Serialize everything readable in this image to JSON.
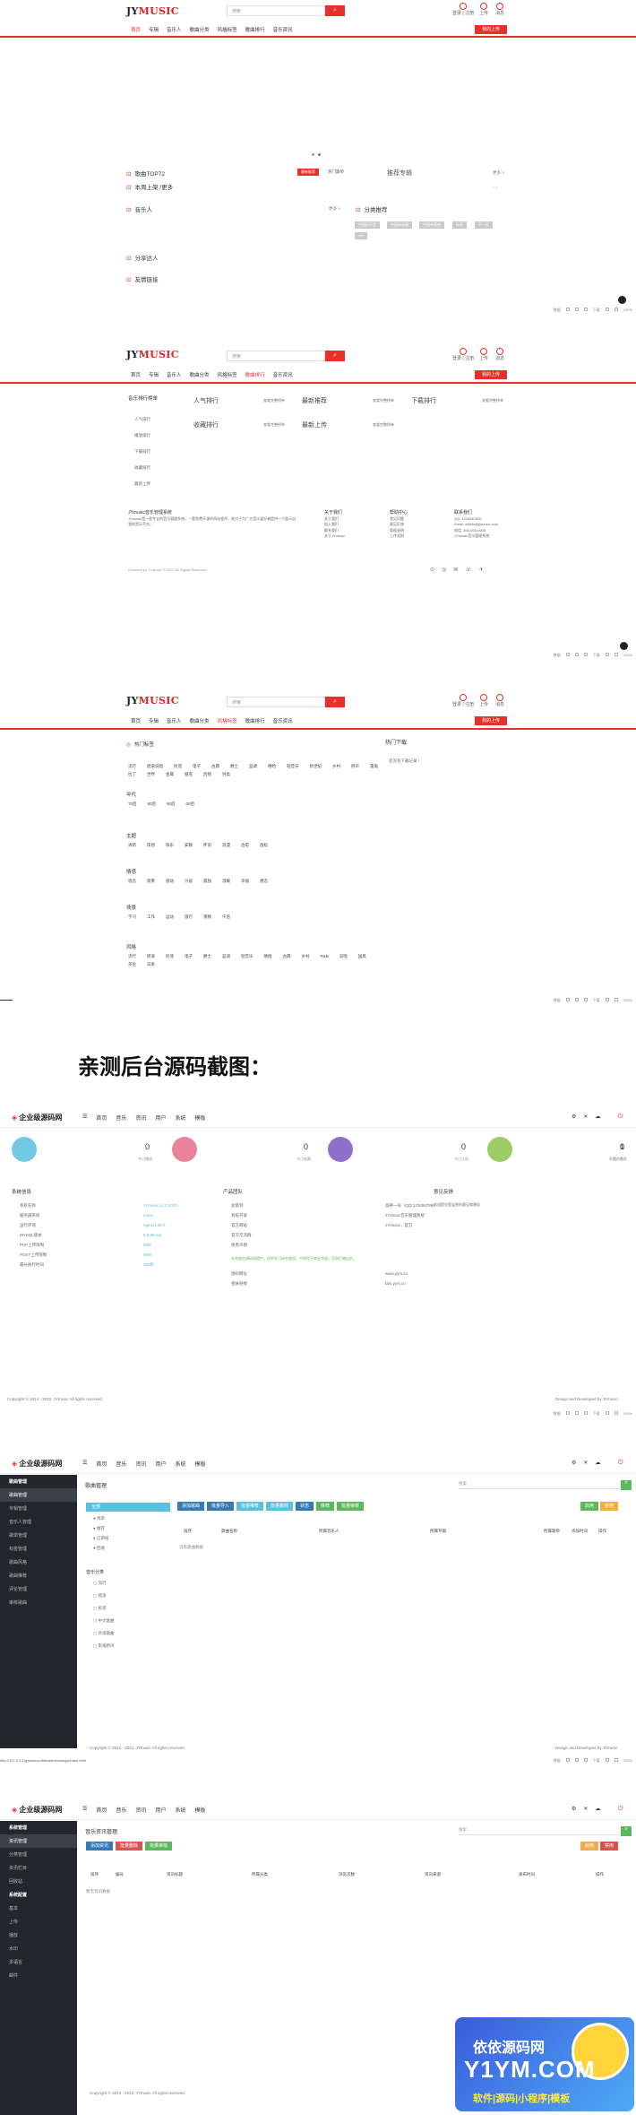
{
  "site": {
    "logo_prefix": "JY",
    "logo_suffix": "MUSIC",
    "search_placeholder": "搜索",
    "search_value_1": "搜索",
    "search_value_2": "搜索",
    "search_value_3": "搜索",
    "login_text": "登录 | 注册",
    "upload_label": "上传",
    "notify_label": "消息",
    "upload_btn": "我的上传",
    "nav": [
      "首页",
      "专辑",
      "音乐人",
      "歌曲分类",
      "风格标签",
      "歌曲排行",
      "音乐资讯"
    ]
  },
  "page1": {
    "top_label": "歌曲TOP72",
    "top_badge": "最新推荐",
    "hot_label": "热门歌单",
    "rec_label": "推荐专辑",
    "more1": "更多 >",
    "sub_label": "本周上架 /更多",
    "singer_label": "音乐人",
    "more2": "更多 >",
    "cat_label": "分类推荐",
    "cat_tags": [
      "中国好声音",
      "中国新说唱",
      "中国有嘻哈",
      "标签",
      "不一样"
    ],
    "cat_tag_extra": "MV",
    "share_label": "分享达人",
    "links_label": "友情链接"
  },
  "statusbar": {
    "items": [
      "数据",
      "下载",
      "100%"
    ]
  },
  "page2": {
    "panel_title": "音乐排行榜单",
    "list": [
      "人气排行",
      "播放排行",
      "下载排行",
      "收藏排行",
      "最新上传"
    ],
    "rank_titles": [
      "人气排行",
      "最新推荐",
      "下载排行",
      "收藏排行",
      "最新上传"
    ],
    "rank_note": "查看完整榜单",
    "footer_about_title": "JYmusic音乐管理系统",
    "footer_about": "JYmusic是一款专业的音乐管理系统，一套免费开源的网站程序，致力于为广大音乐爱好者提供一个展示自我的音乐平台。",
    "footer_cols": [
      {
        "title": "关于我们",
        "items": [
          "关于我们",
          "加入我们",
          "联系我们",
          "关于JYmusic"
        ]
      },
      {
        "title": "帮助中心",
        "items": [
          "常见问题",
          "意见反馈",
          "版权说明",
          "上传须知"
        ]
      },
      {
        "title": "联系我们",
        "items": [
          "QQ: 1234567890",
          "Email: admin@jymusic.com",
          "电话: 400-000-0000",
          "JYmusic音乐管理系统"
        ]
      }
    ],
    "copyright": "Powered by JYmusic © 2022 All Rights Reserved."
  },
  "page3": {
    "hot_tags_title": "热门标签",
    "hot_list_title": "热门下载",
    "hot_list_item": "还没有下载记录 !",
    "groups": [
      {
        "name": "",
        "tags": [
          "流行",
          "摇滚说唱",
          "民谣",
          "电子",
          "古典",
          "爵士",
          "蓝调",
          "嘻哈",
          "轻音乐",
          "新世纪",
          "乡村",
          "原声",
          "雷鬼",
          "拉丁",
          "世界",
          "金属",
          "朋克",
          "后摇",
          "另类"
        ]
      },
      {
        "name": "年代",
        "tags": [
          "70后",
          "80后",
          "90后",
          "00后"
        ]
      },
      {
        "name": "主题",
        "tags": [
          "清新",
          "伤感",
          "快乐",
          "安静",
          "怀旧",
          "浪漫",
          "治愈",
          "放松"
        ]
      },
      {
        "name": "情感",
        "tags": [
          "思念",
          "寂寞",
          "感动",
          "兴奋",
          "孤独",
          "温暖",
          "幸福",
          "想念"
        ]
      },
      {
        "name": "场景",
        "tags": [
          "学习",
          "工作",
          "运动",
          "旅行",
          "夜晚",
          "午后"
        ]
      },
      {
        "name": "风格",
        "tags": [
          "流行",
          "摇滚",
          "民谣",
          "电子",
          "爵士",
          "蓝调",
          "轻音乐",
          "嘻哈",
          "古典",
          "乡村",
          "R&B",
          "说唱",
          "国风",
          "英伦",
          "日系"
        ]
      }
    ]
  },
  "caption": "亲测后台源码截图：",
  "admin": {
    "logo": "企业级源码网",
    "nav": [
      "首页",
      "音乐",
      "资讯",
      "用户",
      "系统",
      "模板"
    ],
    "stats": [
      {
        "num": "0",
        "lbl": "今日播放",
        "color": "#5bc0de"
      },
      {
        "num": "0",
        "lbl": "今日收藏",
        "color": "#e86c8a"
      },
      {
        "num": "0",
        "lbl": "今日注册",
        "color": "#7e57c2"
      },
      {
        "num": "1",
        "lbl": "用户总数",
        "color": "#8bc34a"
      },
      {
        "num": "0",
        "lbl": "歌曲总数",
        "color": "#ff7043"
      }
    ],
    "sys_title": "系统信息",
    "sys_rows": [
      {
        "k": "系统名称",
        "v": "JYmusic v2.0 2022"
      },
      {
        "k": "服务器系统",
        "v": "Linux"
      },
      {
        "k": "运行环境",
        "v": "nginx/1.18.0"
      },
      {
        "k": "MYSQL版本",
        "v": "5.6.50-log"
      },
      {
        "k": "PHP上传限制",
        "v": "50M"
      },
      {
        "k": "POST上传限制",
        "v": "50M"
      },
      {
        "k": "最长执行时间",
        "v": "300秒"
      }
    ],
    "prod_title": "产品团队",
    "prod_rows": [
      {
        "k": "总策划",
        "v": "战神一号（QQ:123456789）"
      },
      {
        "k": "系统开发",
        "v": "JYmusic音乐管理系统"
      },
      {
        "k": "官方网站",
        "v": "JYmusic，官方"
      },
      {
        "k": "官方交流群",
        "v": ""
      },
      {
        "k": "免责声明",
        "v": ""
      }
    ],
    "prod_note": "本系统由源码网提供，仅供学习研究使用，不得用于商业用途，否则后果自负。",
    "prod_rows2": [
      {
        "k": "源码网址",
        "v": "www.yym.cn"
      },
      {
        "k": "相关链接",
        "v": "bbs.yym.cn"
      }
    ],
    "feedback_title": "意见反馈",
    "feedback_text": "欢迎提交您宝贵的意见和建议",
    "copyright": "Copyright © 2014 - 2022, JYmusic All rights reserved.",
    "designed": "Design and Developed by JYmusic",
    "side1": {
      "head": "歌曲管理",
      "items": [
        "歌曲管理",
        "专辑管理",
        "音乐人管理",
        "歌单管理",
        "标签管理",
        "歌曲风格",
        "歌曲推荐",
        "评论管理",
        "审核歌曲"
      ]
    },
    "songs_title": "歌曲管理",
    "songs_btns": [
      {
        "t": "添加歌曲",
        "c": "#337ab7"
      },
      {
        "t": "批量导入",
        "c": "#337ab7"
      },
      {
        "t": "批量推荐",
        "c": "#5bc0de"
      },
      {
        "t": "批量删除",
        "c": "#5bc0de"
      },
      {
        "t": "状态",
        "c": "#337ab7"
      },
      {
        "t": "推荐",
        "c": "#5cb85c"
      },
      {
        "t": "批量审核",
        "c": "#5cb85c"
      }
    ],
    "songs_right_btns": [
      "启用",
      "禁用"
    ],
    "songs_search": "搜索",
    "songs_tree_root": "全部",
    "songs_tree": [
      "待审",
      "推荐",
      "已审核",
      "回收"
    ],
    "songs_cat_title": "音乐分类",
    "songs_cats": [
      "流行",
      "摇滚",
      "民谣",
      "中文歌曲",
      "外语歌曲",
      "影视原声"
    ],
    "songs_cols": [
      "排序",
      "歌曲名称",
      "所属音乐人",
      "所属专辑",
      "所属歌单",
      "添加时间",
      "操作"
    ],
    "songs_empty": "没有歌曲数据",
    "side2": {
      "head1": "系统管理",
      "items1": [
        "资讯管理",
        "分类管理",
        "资讯栏目",
        "回收站"
      ],
      "head2": "系统配置",
      "items2": [
        "基本",
        "上传",
        "播放",
        "水印",
        "多语言",
        "邮件"
      ]
    },
    "news_title": "音乐资讯管理",
    "news_btns": [
      {
        "t": "添加资讯",
        "c": "#337ab7"
      },
      {
        "t": "批量删除",
        "c": "#d9534f"
      },
      {
        "t": "批量审核",
        "c": "#5cb85c"
      }
    ],
    "news_right_btns": [
      "启用",
      "禁用"
    ],
    "news_cols": [
      "排序",
      "编号",
      "资讯标题",
      "所属分类",
      "浏览次数",
      "资讯来源",
      "发布时间",
      "操作"
    ],
    "news_empty": "暂无资讯数据"
  },
  "url_bar": "http://127.0.0.1/jymusic/public/admin/songs/index.html",
  "watermark": {
    "line1": "依依源码网",
    "line2": "Y1YM.COM",
    "line3": "软件|源码|小程序|模板"
  }
}
